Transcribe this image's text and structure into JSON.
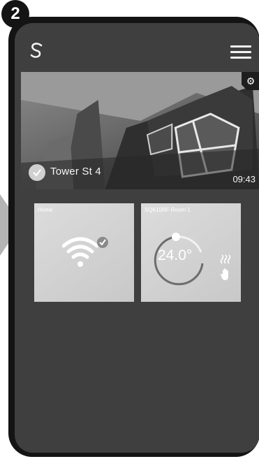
{
  "step": "2",
  "header": {
    "logo_icon": "salus-logo-icon",
    "menu_icon": "hamburger-menu-icon"
  },
  "home_banner": {
    "name": "Tower St 4",
    "time": "09:43",
    "settings_icon": "gear-icon",
    "status_icon": "check-circle-icon"
  },
  "devices": [
    {
      "title": "Home",
      "icon": "wifi-connected-icon"
    },
    {
      "title": "SQ610RF Room 1",
      "temperature": "24.0°",
      "icons": [
        "heating-icon",
        "manual-hand-icon"
      ]
    }
  ],
  "colors": {
    "frame": "#141414",
    "screen": "#3f3f3f",
    "tile": "#d2d2d2",
    "text": "#ffffff"
  }
}
